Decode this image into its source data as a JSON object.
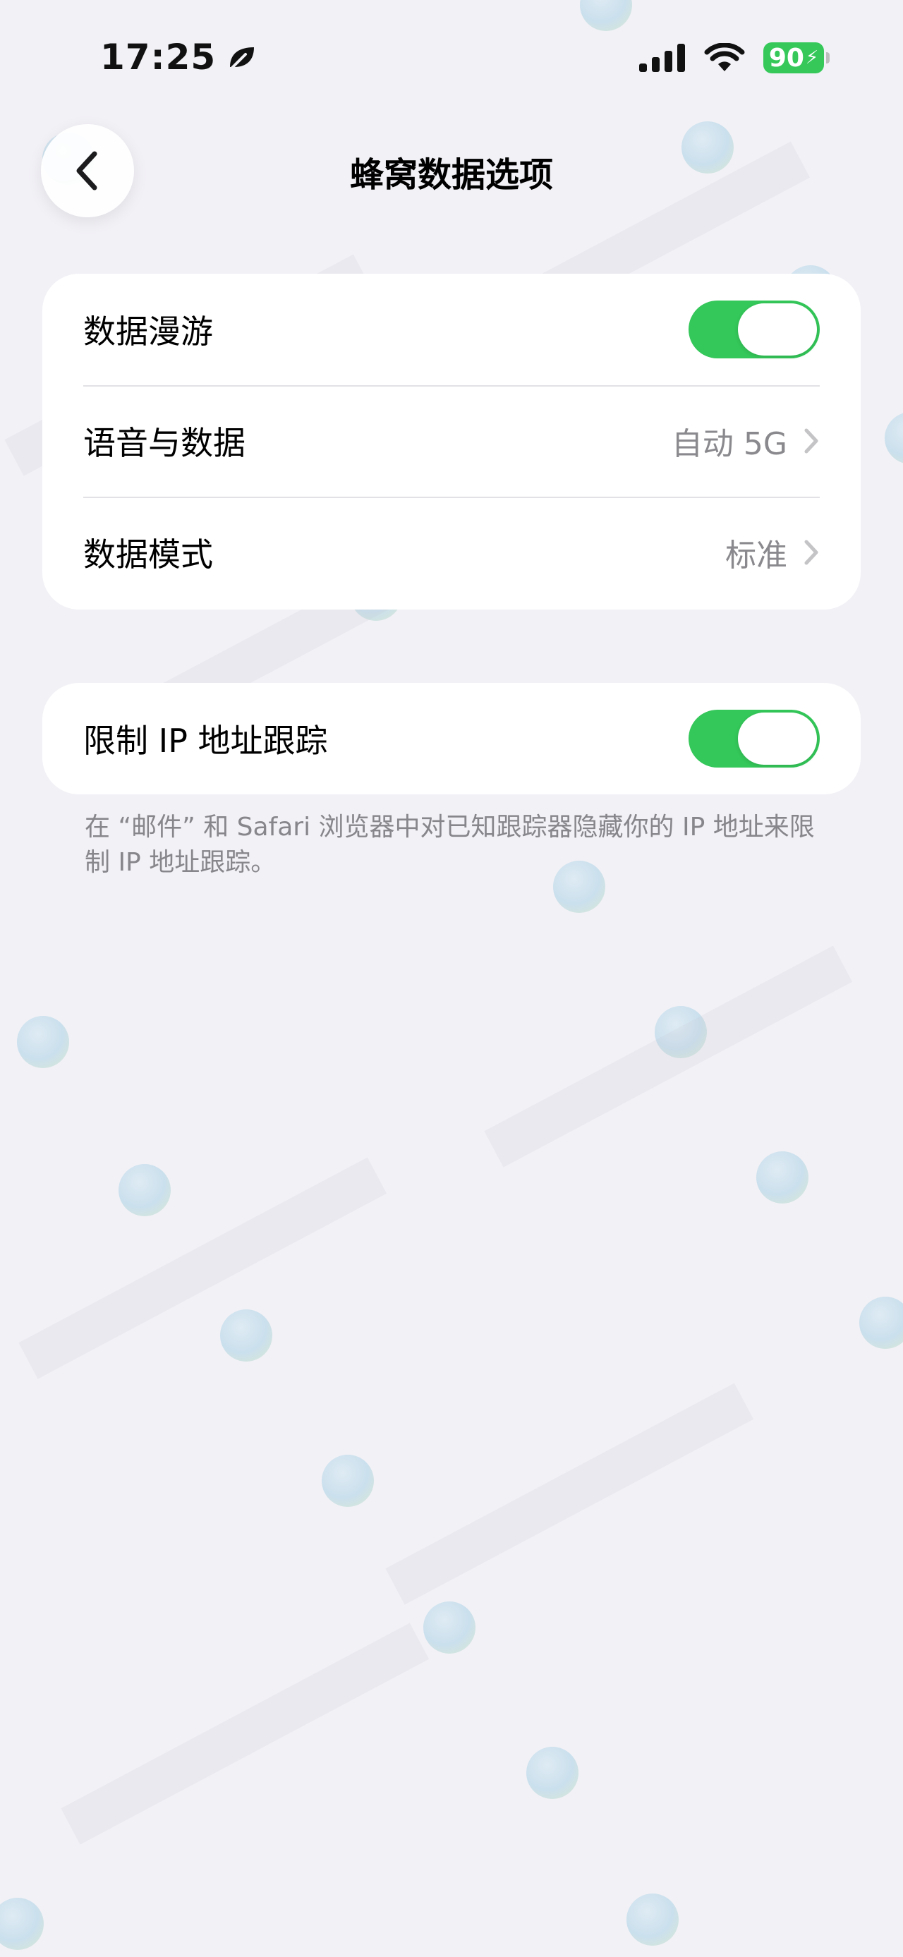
{
  "status_bar": {
    "time": "17:25",
    "battery_level": "90",
    "icons": [
      "leaf-icon",
      "signal-icon",
      "wifi-icon",
      "battery-charging-icon"
    ]
  },
  "header": {
    "title": "蜂窝数据选项",
    "back_icon": "chevron-left-icon"
  },
  "group1": {
    "rows": [
      {
        "label": "数据漫游",
        "control": "toggle",
        "on": true
      },
      {
        "label": "语音与数据",
        "value": "自动 5G",
        "control": "disclosure"
      },
      {
        "label": "数据模式",
        "value": "标准",
        "control": "disclosure"
      }
    ]
  },
  "group2": {
    "rows": [
      {
        "label": "限制 IP 地址跟踪",
        "control": "toggle",
        "on": true
      }
    ],
    "footer": "在 “邮件” 和 Safari 浏览器中对已知跟踪器隐藏你的 IP 地址来限制 IP 地址跟踪。"
  },
  "colors": {
    "background": "#f2f1f6",
    "toggle_on": "#34c759",
    "secondary_text": "#8a8a8e",
    "battery": "#36c95a"
  }
}
